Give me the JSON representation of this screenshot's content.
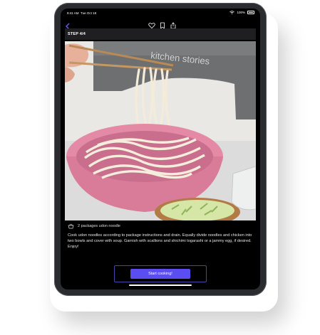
{
  "status": {
    "time": "9:41 AM",
    "date": "Tue Oct 18",
    "battery": "100%"
  },
  "nav": {
    "back_icon": "chevron-left-icon",
    "actions": [
      "heart-icon",
      "bookmark-icon",
      "share-icon"
    ]
  },
  "step": {
    "label": "STEP 4/4"
  },
  "photo": {
    "apron_text": "kitchen stories"
  },
  "ingredient": {
    "icon": "basket-icon",
    "text": "2 packages udon noodle"
  },
  "instructions": "Cook udon noodles according to package instructions and drain. Equally divide noodles and chicken into two bowls and cover with soup. Garnish with scallions and shichimi togarashi or a jammy egg, if desired. Enjoy!",
  "cta": {
    "label": "Start cooking!"
  },
  "colors": {
    "accent": "#5b4ef0",
    "screen_bg": "#000000"
  }
}
